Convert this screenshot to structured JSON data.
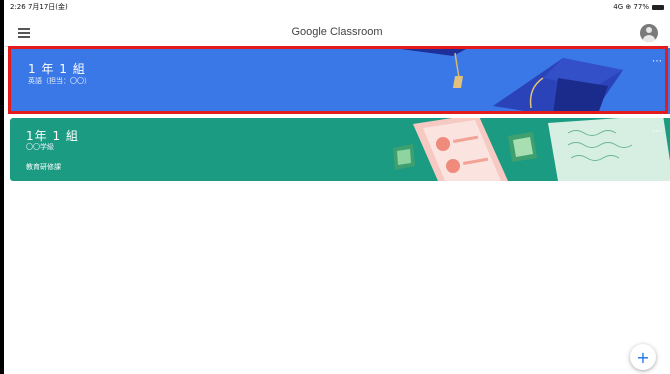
{
  "status_bar": {
    "left": "2:26 7月17日(金)",
    "right": "4G ⊕ 77%"
  },
  "app_bar": {
    "title": "Google Classroom",
    "menu_icon": "hamburger-menu-icon",
    "avatar_icon": "account-avatar-icon"
  },
  "classes": [
    {
      "name": "1 年 1 組",
      "subtitle": "英語（担当：〇〇）",
      "color": "#3b78e7",
      "more_label": "⋯"
    },
    {
      "name": "1年 1 組",
      "subtitle": "〇〇学級",
      "teacher": "教育研修課",
      "color": "#1a9b82",
      "more_label": "⋯"
    }
  ],
  "highlight_color": "#e31b1b",
  "fab": {
    "label": "+",
    "icon": "plus-icon"
  }
}
